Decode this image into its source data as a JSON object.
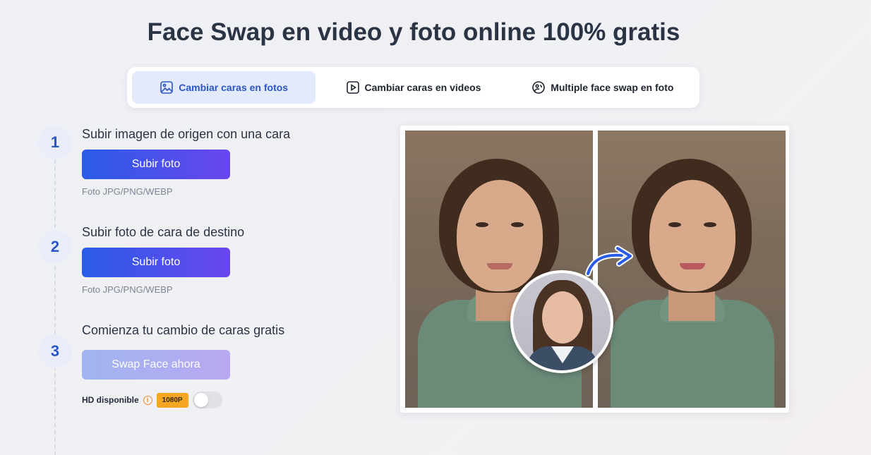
{
  "page": {
    "title": "Face Swap en video y foto online 100% gratis"
  },
  "tabs": [
    {
      "label": "Cambiar caras en fotos",
      "icon": "image-icon",
      "active": true
    },
    {
      "label": "Cambiar caras en videos",
      "icon": "play-icon",
      "active": false
    },
    {
      "label": "Multiple face swap en foto",
      "icon": "multi-face-icon",
      "active": false
    }
  ],
  "steps": [
    {
      "number": "1",
      "title": "Subir imagen de origen con una cara",
      "button": "Subir foto",
      "hint": "Foto JPG/PNG/WEBP"
    },
    {
      "number": "2",
      "title": "Subir foto de cara de destino",
      "button": "Subir foto",
      "hint": "Foto JPG/PNG/WEBP"
    },
    {
      "number": "3",
      "title": "Comienza tu cambio de caras gratis",
      "button": "Swap Face ahora"
    }
  ],
  "hd": {
    "label": "HD disponible",
    "info_icon": "i",
    "badge": "1080P",
    "enabled": false
  },
  "colors": {
    "accent": "#2d55c5",
    "button_start": "#2a5ce8",
    "button_end": "#6a45f0",
    "badge": "#f5a623",
    "info": "#f08a24"
  }
}
